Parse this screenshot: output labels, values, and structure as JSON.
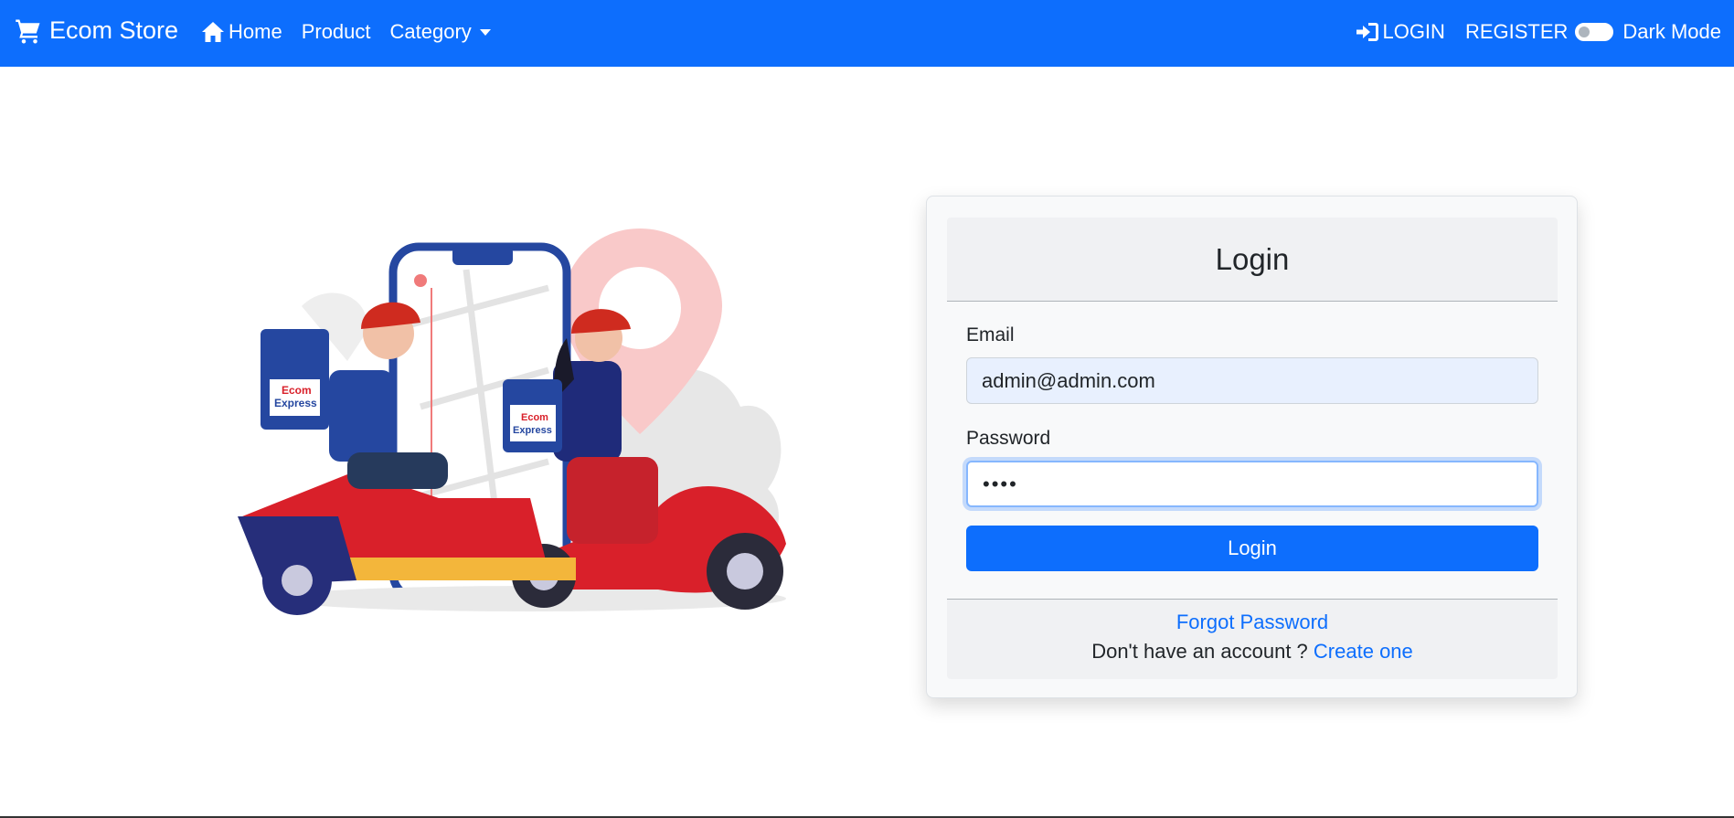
{
  "navbar": {
    "brand": "Ecom Store",
    "home": "Home",
    "product": "Product",
    "category": "Category",
    "login": "LOGIN",
    "register": "REGISTER",
    "dark_mode": "Dark Mode",
    "dark_mode_on": false,
    "bg_color": "#0d6efd"
  },
  "illustration": {
    "box_text_line1": "Ecom",
    "box_text_line2": "Express"
  },
  "login_card": {
    "title": "Login",
    "email_label": "Email",
    "email_value": "admin@admin.com",
    "password_label": "Password",
    "password_value": "••••",
    "submit_label": "Login",
    "forgot_password": "Forgot Password",
    "no_account_text": "Don't have an account ?",
    "create_link": "Create one",
    "accent": "#0d6efd"
  }
}
